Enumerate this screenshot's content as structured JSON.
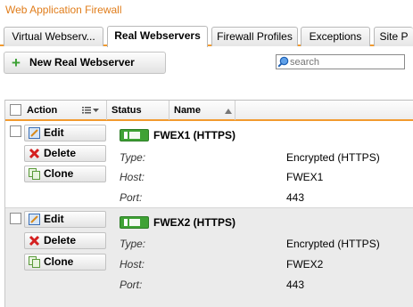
{
  "app": {
    "title": "Web Application Firewall"
  },
  "tabs": [
    {
      "label": "Virtual Webserv..."
    },
    {
      "label": "Real Webservers",
      "active": true
    },
    {
      "label": "Firewall Profiles"
    },
    {
      "label": "Exceptions"
    },
    {
      "label": "Site P"
    }
  ],
  "toolbar": {
    "new_label": "New Real Webserver",
    "new_icon": "plus-icon"
  },
  "search": {
    "placeholder": "search",
    "value": ""
  },
  "grid": {
    "columns": {
      "action": "Action",
      "status": "Status",
      "name": "Name"
    },
    "rows": [
      {
        "status": "enabled",
        "name": "FWEX1 (HTTPS)",
        "buttons": {
          "edit": "Edit",
          "delete": "Delete",
          "clone": "Clone"
        },
        "fields": [
          {
            "label": "Type:",
            "value": "Encrypted (HTTPS)"
          },
          {
            "label": "Host:",
            "value": "FWEX1"
          },
          {
            "label": "Port:",
            "value": "443"
          }
        ]
      },
      {
        "status": "enabled",
        "name": "FWEX2 (HTTPS)",
        "buttons": {
          "edit": "Edit",
          "delete": "Delete",
          "clone": "Clone"
        },
        "fields": [
          {
            "label": "Type:",
            "value": "Encrypted (HTTPS)"
          },
          {
            "label": "Host:",
            "value": "FWEX2"
          },
          {
            "label": "Port:",
            "value": "443"
          }
        ]
      }
    ]
  },
  "colors": {
    "accent": "#f29a2e",
    "title": "#e07d1b",
    "status_on": "#3fa235"
  }
}
